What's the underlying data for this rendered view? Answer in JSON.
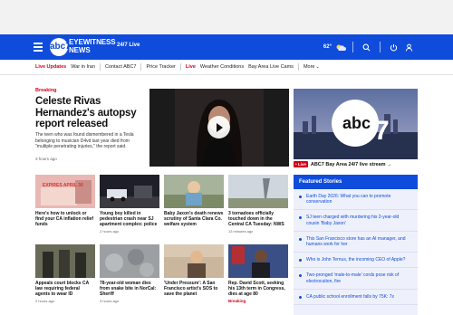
{
  "header": {
    "brand_line1": "EYEWITNESS",
    "brand_line2": "NEWS",
    "logo_text": "abc7",
    "live_label": "24/7 Live",
    "temperature": "62°"
  },
  "subnav": {
    "items": [
      {
        "label": "Live Updates",
        "live": true
      },
      {
        "label": "War in Iran",
        "live": false
      },
      {
        "label": "Contact ABC7",
        "live": false
      },
      {
        "label": "Price Tracker",
        "live": false
      },
      {
        "label": "Live",
        "live": true
      },
      {
        "label": "Weather Conditions",
        "live": false
      },
      {
        "label": "Bay Area Live Cams",
        "live": false
      }
    ],
    "more_label": "More"
  },
  "lead": {
    "kicker": "Breaking",
    "title": "Celeste Rivas Hernandez's autopsy report released",
    "summary": "The teen who was found dismembered in a Tesla belonging to musician D4vd last year died from \"multiple penetrating injuries,\" the report said.",
    "time": "3 hours ago"
  },
  "live_stream": {
    "badge": "• Live",
    "caption": "ABC7 Bay Area 24/7 live stream →"
  },
  "cards": [
    {
      "title": "Here's how to unlock or find your CA inflation relief funds",
      "time": "",
      "breaking": "",
      "thumb_text": "EXPIRES APRIL 30"
    },
    {
      "title": "Young boy killed in pedestrian crash near SJ apartment complex: police",
      "time": "2 hours ago",
      "breaking": "",
      "thumb_text": ""
    },
    {
      "title": "Baby Jaxon's death renews scrutiny of Santa Clara Co. welfare system",
      "time": "",
      "breaking": "",
      "thumb_text": ""
    },
    {
      "title": "3 tornadoes officially touched down in the Central CA Tuesday: NWS",
      "time": "13 minutes ago",
      "breaking": "",
      "thumb_text": ""
    },
    {
      "title": "Appeals court blocks CA law requiring federal agents to wear ID",
      "time": "2 hours ago",
      "breaking": "",
      "thumb_text": ""
    },
    {
      "title": "78-year-old woman dies from snake bite in NorCal: Sheriff",
      "time": "3 hours ago",
      "breaking": "",
      "thumb_text": ""
    },
    {
      "title": "'Under Pressure': A San Francisco artist's SOS to save the planet",
      "time": "",
      "breaking": "",
      "thumb_text": ""
    },
    {
      "title": "Rep. David Scott, seeking his 13th term in Congress, dies at age 80",
      "time": "",
      "breaking": "Breaking",
      "thumb_text": ""
    }
  ],
  "featured": {
    "heading": "Featured Stories",
    "items": [
      "Earth Day 2026: What you can to promote conservation",
      "SJ teen charged with murdering his 2-year-old cousin 'Baby Jaxon'",
      "This San Francisco store has an AI manager, and humans work for her",
      "Who is John Ternus, the incoming CEO of Apple?",
      "Two-pronged 'male-to-male' cords pose risk of electrocution, fire",
      "CA public school enrollment falls by 75K: 7x"
    ]
  }
}
